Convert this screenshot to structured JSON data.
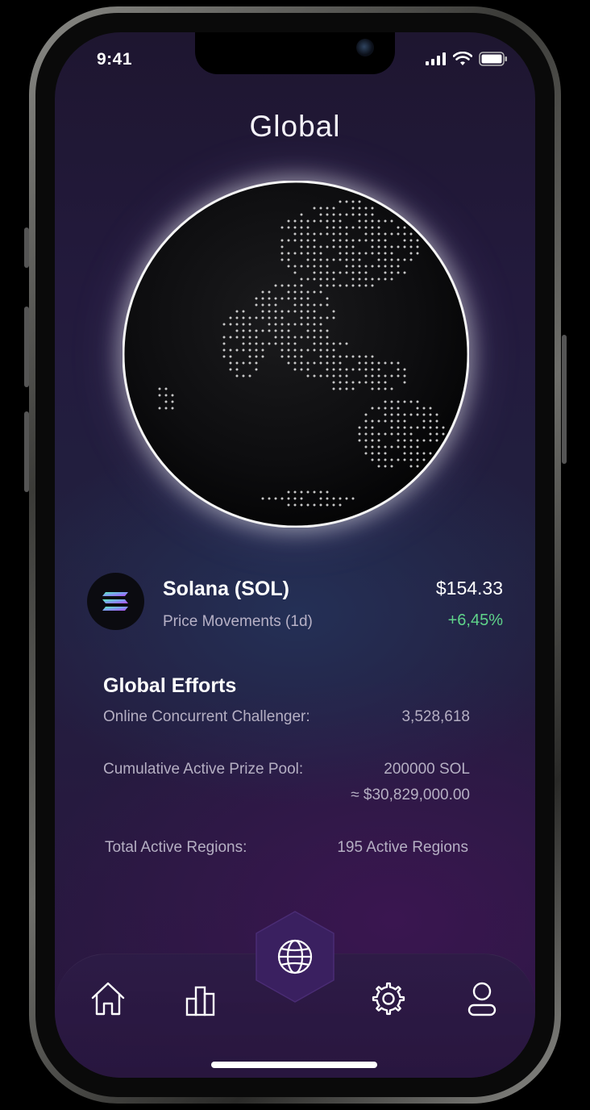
{
  "status_bar": {
    "time": "9:41"
  },
  "page": {
    "title": "Global"
  },
  "coin": {
    "name": "Solana (SOL)",
    "subtitle": "Price Movements (1d)",
    "price": "$154.33",
    "change": "+6,45%"
  },
  "efforts": {
    "title": "Global Efforts",
    "rows": [
      {
        "label": "Online Concurrent Challenger:",
        "value": "3,528,618"
      },
      {
        "label": "Cumulative Active Prize Pool:",
        "value": "200000 SOL",
        "value2": "≈ $30,829,000.00"
      },
      {
        "label": "Total Active Regions:",
        "value": "195 Active Regions"
      }
    ]
  },
  "nav": {
    "items": [
      {
        "icon": "home-icon"
      },
      {
        "icon": "bar-chart-icon"
      },
      {
        "icon": "globe-icon",
        "active": true
      },
      {
        "icon": "gear-icon"
      },
      {
        "icon": "user-icon"
      }
    ]
  },
  "colors": {
    "accent_green": "#5fd38a",
    "hex_active": "#3a2060"
  }
}
